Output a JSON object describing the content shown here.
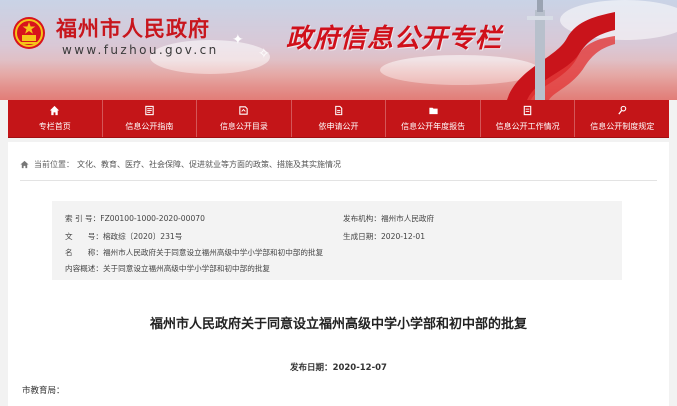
{
  "header": {
    "site_name": "福州市人民政府",
    "site_url": "www.fuzhou.gov.cn",
    "column_title": "政府信息公开专栏"
  },
  "nav": {
    "items": [
      {
        "label": "专栏首页",
        "icon": "home-icon"
      },
      {
        "label": "信息公开指南",
        "icon": "guide-icon"
      },
      {
        "label": "信息公开目录",
        "icon": "catalog-icon"
      },
      {
        "label": "依申请公开",
        "icon": "application-icon"
      },
      {
        "label": "信息公开年度报告",
        "icon": "report-icon"
      },
      {
        "label": "信息公开工作情况",
        "icon": "work-status-icon"
      },
      {
        "label": "信息公开制度规定",
        "icon": "regulation-icon"
      }
    ]
  },
  "breadcrumb": {
    "label": "当前位置：",
    "path": "文化、教育、医疗、社会保障、促进就业等方面的政策、措施及其实施情况"
  },
  "meta": {
    "index_label": "索 引 号：",
    "index_value": "FZ00100-1000-2020-00070",
    "issuer_label": "发布机构：",
    "issuer_value": "福州市人民政府",
    "doc_no_label": "文　　号：",
    "doc_no_value": "榕政综〔2020〕231号",
    "date_label": "生成日期：",
    "date_value": "2020-12-01",
    "name_label": "名　　称：",
    "name_value": "福州市人民政府关于同意设立福州高级中学小学部和初中部的批复",
    "summary_label": "内容概述：",
    "summary_value": "关于同意设立福州高级中学小学部和初中部的批复"
  },
  "article": {
    "title": "福州市人民政府关于同意设立福州高级中学小学部和初中部的批复",
    "publish_label": "发布日期：",
    "publish_date": "2020-12-07",
    "salutation": "市教育局："
  },
  "colors": {
    "nav_red": "#c41518",
    "title_red": "#d0101a",
    "meta_bg": "#f3f3f3"
  }
}
